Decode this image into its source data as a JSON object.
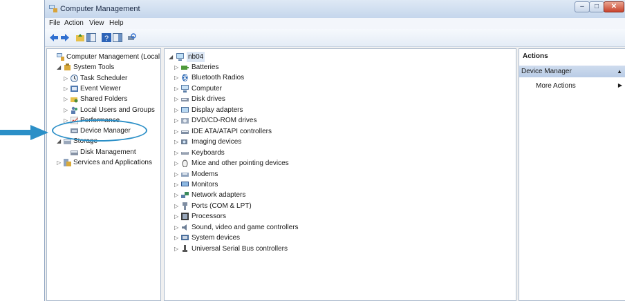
{
  "window": {
    "title": "Computer Management"
  },
  "menu": [
    "File",
    "Action",
    "View",
    "Help"
  ],
  "left_tree": [
    {
      "label": "Computer Management (Local",
      "level": 0,
      "expander": "",
      "icon": "computer-management-icon"
    },
    {
      "label": "System Tools",
      "level": 1,
      "expander": "◢",
      "icon": "tools-icon"
    },
    {
      "label": "Task Scheduler",
      "level": 2,
      "expander": "▷",
      "icon": "clock-icon"
    },
    {
      "label": "Event Viewer",
      "level": 2,
      "expander": "▷",
      "icon": "event-viewer-icon"
    },
    {
      "label": "Shared Folders",
      "level": 2,
      "expander": "▷",
      "icon": "shared-folder-icon"
    },
    {
      "label": "Local Users and Groups",
      "level": 2,
      "expander": "▷",
      "icon": "users-icon"
    },
    {
      "label": "Performance",
      "level": 2,
      "expander": "▷",
      "icon": "performance-icon"
    },
    {
      "label": "Device Manager",
      "level": 2,
      "expander": "",
      "icon": "device-manager-icon"
    },
    {
      "label": "Storage",
      "level": 1,
      "expander": "◢",
      "icon": "storage-icon"
    },
    {
      "label": "Disk Management",
      "level": 2,
      "expander": "",
      "icon": "disk-icon"
    },
    {
      "label": "Services and Applications",
      "level": 1,
      "expander": "▷",
      "icon": "services-icon"
    }
  ],
  "device_tree": {
    "root": "nb04",
    "categories": [
      "Batteries",
      "Bluetooth Radios",
      "Computer",
      "Disk drives",
      "Display adapters",
      "DVD/CD-ROM drives",
      "IDE ATA/ATAPI controllers",
      "Imaging devices",
      "Keyboards",
      "Mice and other pointing devices",
      "Modems",
      "Monitors",
      "Network adapters",
      "Ports (COM & LPT)",
      "Processors",
      "Sound, video and game controllers",
      "System devices",
      "Universal Serial Bus controllers"
    ]
  },
  "actions": {
    "header": "Actions",
    "section": "Device Manager",
    "more": "More Actions"
  },
  "colors": {
    "highlight": "#2b8fc7",
    "selection": "#c5d6ec"
  }
}
